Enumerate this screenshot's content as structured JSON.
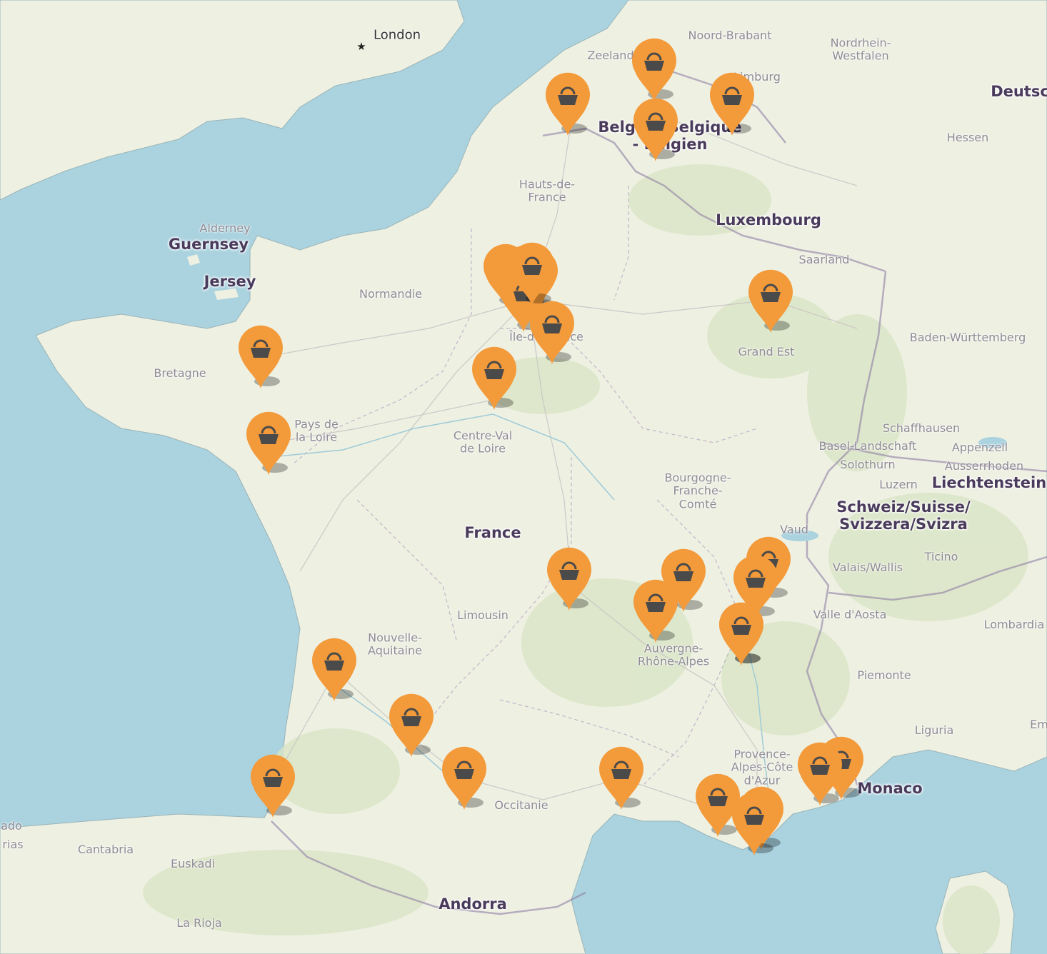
{
  "map": {
    "colors": {
      "water": "#aad3df",
      "land": "#eef0e2",
      "forest": "#d7e3c4",
      "border": "#8a9a7a",
      "marker": "#f39a3a",
      "marker_icon": "#4a4a4a"
    },
    "marker_icon": "basket-icon",
    "labels": [
      {
        "id": "london",
        "text": "London",
        "kind": "city"
      },
      {
        "id": "noord-brabant",
        "text": "Noord-Brabant",
        "kind": "region"
      },
      {
        "id": "zeeland",
        "text": "Zeeland",
        "kind": "region"
      },
      {
        "id": "nordrhein",
        "text": "Nordrhein-\nWestfalen",
        "kind": "region"
      },
      {
        "id": "limburg",
        "text": "Limburg",
        "kind": "region"
      },
      {
        "id": "deutschland",
        "text": "Deutsc",
        "kind": "country"
      },
      {
        "id": "belgique",
        "text": "België - Belgique\n- Belgien",
        "kind": "country"
      },
      {
        "id": "hessen",
        "text": "Hessen",
        "kind": "region"
      },
      {
        "id": "hauts-de-france",
        "text": "Hauts-de-\nFrance",
        "kind": "region"
      },
      {
        "id": "luxembourg",
        "text": "Luxembourg",
        "kind": "country"
      },
      {
        "id": "alderney",
        "text": "Alderney",
        "kind": "region"
      },
      {
        "id": "guernsey",
        "text": "Guernsey",
        "kind": "country"
      },
      {
        "id": "jersey",
        "text": "Jersey",
        "kind": "country"
      },
      {
        "id": "saarland",
        "text": "Saarland",
        "kind": "region"
      },
      {
        "id": "normandie",
        "text": "Normandie",
        "kind": "region"
      },
      {
        "id": "ile-de-france",
        "text": "Île-de-France",
        "kind": "region"
      },
      {
        "id": "grand-est",
        "text": "Grand Est",
        "kind": "region"
      },
      {
        "id": "baden",
        "text": "Baden-Württemberg",
        "kind": "region"
      },
      {
        "id": "bretagne",
        "text": "Bretagne",
        "kind": "region"
      },
      {
        "id": "pays-de-la-loire",
        "text": "Pays de\nla Loire",
        "kind": "region"
      },
      {
        "id": "centre-val-de-loire",
        "text": "Centre-Val\nde Loire",
        "kind": "region"
      },
      {
        "id": "schaffhausen",
        "text": "Schaffhausen",
        "kind": "region"
      },
      {
        "id": "basel",
        "text": "Basel-Landschaft",
        "kind": "region"
      },
      {
        "id": "appenzell",
        "text": "Appenzell",
        "kind": "region"
      },
      {
        "id": "solothurn",
        "text": "Solothurn",
        "kind": "region"
      },
      {
        "id": "ausserrhoden",
        "text": "Ausserrhoden",
        "kind": "region"
      },
      {
        "id": "luzern",
        "text": "Luzern",
        "kind": "region"
      },
      {
        "id": "liechtenstein",
        "text": "Liechtenstein",
        "kind": "country"
      },
      {
        "id": "bourgogne",
        "text": "Bourgogne-\nFranche-\nComté",
        "kind": "region"
      },
      {
        "id": "schweiz",
        "text": "Schweiz/Suisse/\nSvizzera/Svizra",
        "kind": "country"
      },
      {
        "id": "vaud",
        "text": "Vaud",
        "kind": "region"
      },
      {
        "id": "france",
        "text": "France",
        "kind": "country"
      },
      {
        "id": "valais",
        "text": "Valais/Wallis",
        "kind": "region"
      },
      {
        "id": "ticino",
        "text": "Ticino",
        "kind": "region"
      },
      {
        "id": "limousin",
        "text": "Limousin",
        "kind": "region"
      },
      {
        "id": "valle-daosta",
        "text": "Valle d'Aosta",
        "kind": "region"
      },
      {
        "id": "lombardia",
        "text": "Lombardia",
        "kind": "region"
      },
      {
        "id": "nouvelle-aquitaine",
        "text": "Nouvelle-\nAquitaine",
        "kind": "region"
      },
      {
        "id": "auvergne",
        "text": "Auvergne-\nRhône-Alpes",
        "kind": "region"
      },
      {
        "id": "piemonte",
        "text": "Piemonte",
        "kind": "region"
      },
      {
        "id": "liguria",
        "text": "Liguria",
        "kind": "region"
      },
      {
        "id": "em",
        "text": "Em",
        "kind": "region"
      },
      {
        "id": "provence",
        "text": "Provence-\nAlpes-Côte\nd'Azur",
        "kind": "region"
      },
      {
        "id": "monaco",
        "text": "Monaco",
        "kind": "country"
      },
      {
        "id": "occitanie",
        "text": "Occitanie",
        "kind": "region"
      },
      {
        "id": "cantabria",
        "text": "Cantabria",
        "kind": "region"
      },
      {
        "id": "euskadi",
        "text": "Euskadi",
        "kind": "region"
      },
      {
        "id": "ado",
        "text": "ado",
        "kind": "region"
      },
      {
        "id": "rias",
        "text": "rias",
        "kind": "region"
      },
      {
        "id": "andorra",
        "text": "Andorra",
        "kind": "country"
      },
      {
        "id": "la-rioja",
        "text": "La Rioja",
        "kind": "region"
      }
    ],
    "markers": [
      {
        "id": "lille"
      },
      {
        "id": "antwerpen"
      },
      {
        "id": "bruxelles"
      },
      {
        "id": "liege"
      },
      {
        "id": "paris-1"
      },
      {
        "id": "paris-2"
      },
      {
        "id": "paris-3"
      },
      {
        "id": "paris-4"
      },
      {
        "id": "paris-5"
      },
      {
        "id": "paris-6"
      },
      {
        "id": "melun"
      },
      {
        "id": "metz"
      },
      {
        "id": "rennes"
      },
      {
        "id": "orleans"
      },
      {
        "id": "nantes"
      },
      {
        "id": "vichy"
      },
      {
        "id": "lyon-1"
      },
      {
        "id": "lyon-2"
      },
      {
        "id": "geneve"
      },
      {
        "id": "annecy"
      },
      {
        "id": "chambery"
      },
      {
        "id": "grenoble"
      },
      {
        "id": "bordeaux"
      },
      {
        "id": "agen"
      },
      {
        "id": "bayonne"
      },
      {
        "id": "toulouse"
      },
      {
        "id": "montpellier"
      },
      {
        "id": "marseille"
      },
      {
        "id": "toulon-1"
      },
      {
        "id": "toulon-2"
      },
      {
        "id": "nice-1"
      },
      {
        "id": "nice-2"
      }
    ]
  }
}
